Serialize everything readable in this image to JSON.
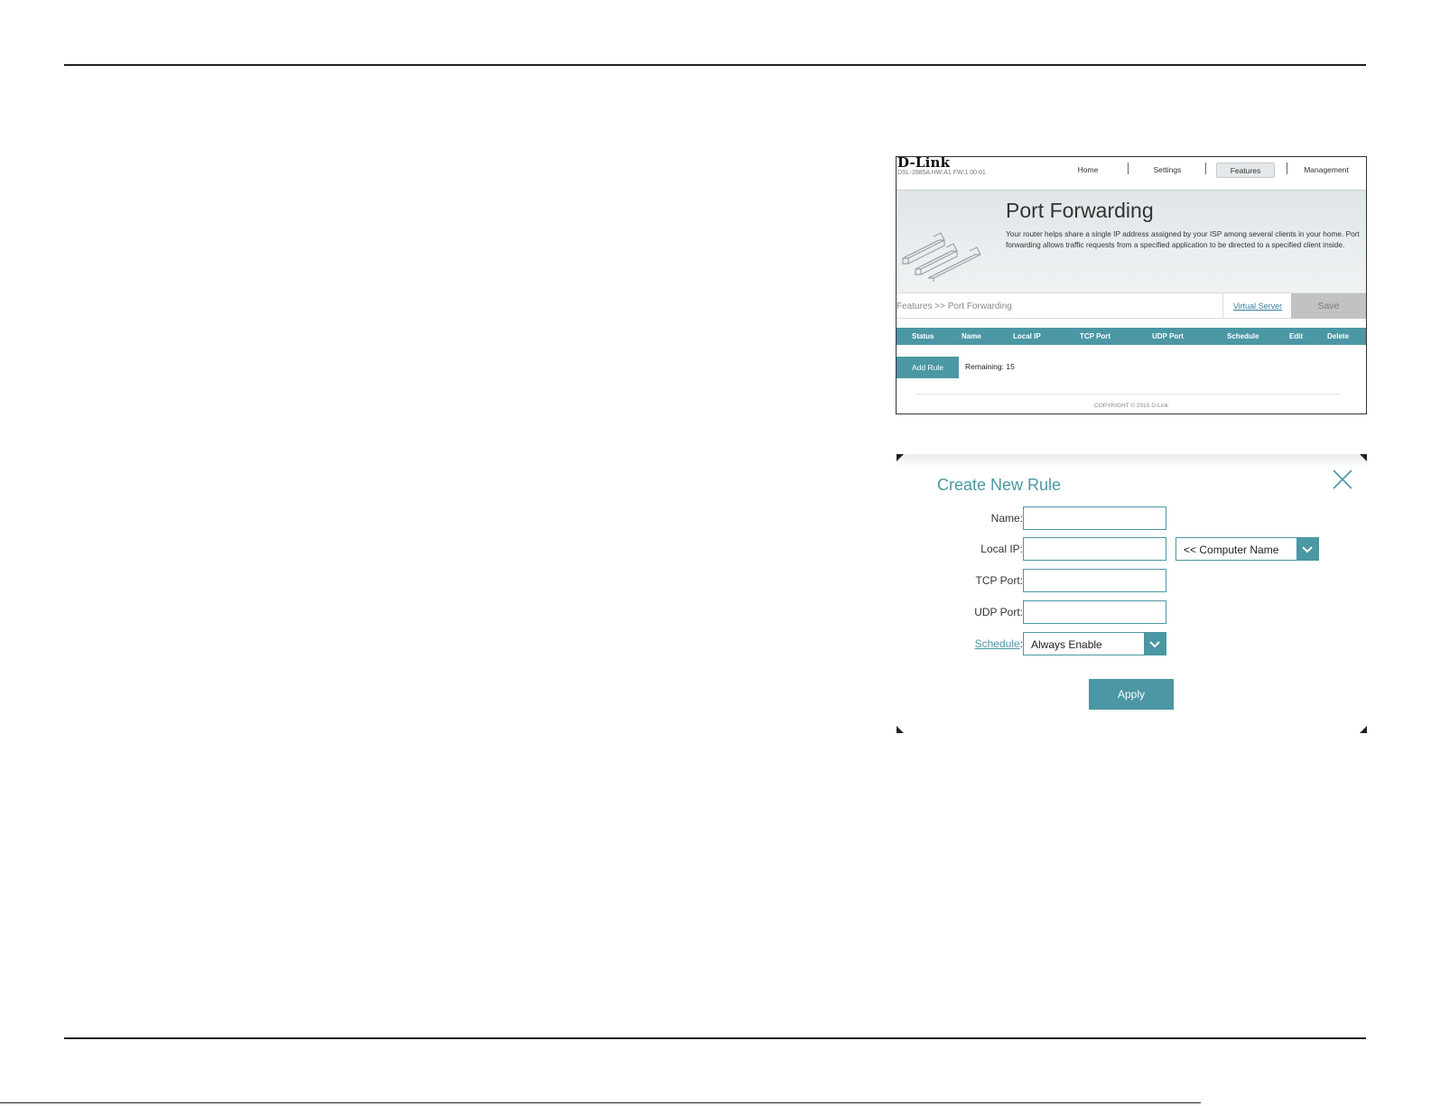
{
  "router": {
    "brand": "D-Link",
    "model_info": "DSL-2885A   HW:A1   FW:1.00.01",
    "nav": [
      "Home",
      "Settings",
      "Features",
      "Management"
    ],
    "active_nav": "Features",
    "page_title": "Port Forwarding",
    "description": "Your router helps share a single IP address assigned by your ISP among several clients in your home. Port forwarding allows traffic requests from a specified application to be directed to a specified client inside.",
    "breadcrumb": "Features >> Port Forwarding",
    "virtual_server_link": "Virtual Server",
    "save_label": "Save",
    "table_headers": [
      "Status",
      "Name",
      "Local IP",
      "TCP Port",
      "UDP Port",
      "Schedule",
      "Edit",
      "Delete"
    ],
    "add_rule_label": "Add Rule",
    "remaining_label": "Remaining: 15",
    "copyright": "COPYRIGHT © 2015 D-Link"
  },
  "dialog": {
    "title": "Create New Rule",
    "name_label": "Name:",
    "local_ip_label": "Local IP:",
    "tcp_port_label": "TCP Port:",
    "udp_port_label": "UDP Port:",
    "schedule_link": "Schedule",
    "schedule_colon": ":",
    "name_value": "",
    "local_ip_value": "",
    "tcp_port_value": "",
    "udp_port_value": "",
    "computer_name_option": "<< Computer Name",
    "schedule_option": "Always Enable",
    "apply_label": "Apply"
  },
  "colors": {
    "accent": "#4b97a4",
    "link": "#3a7ea0",
    "save_disabled": "#c2c2c2"
  }
}
